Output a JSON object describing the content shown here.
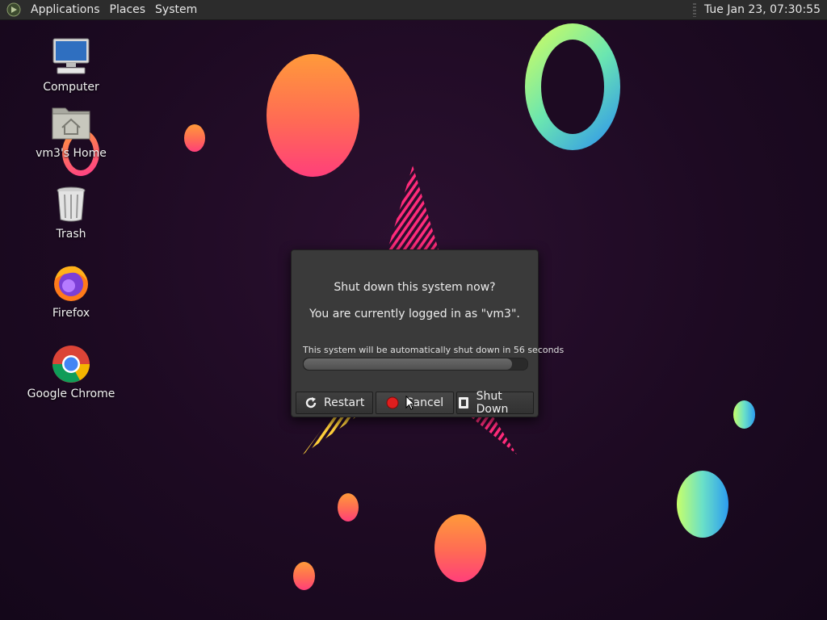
{
  "top_panel": {
    "menus": [
      "Applications",
      "Places",
      "System"
    ],
    "clock": "Tue Jan 23, 07:30:55"
  },
  "desktop": {
    "icons": [
      {
        "label": "Computer",
        "icon": "computer-icon"
      },
      {
        "label": "vm3's Home",
        "icon": "home-folder-icon"
      },
      {
        "label": "Trash",
        "icon": "trash-icon"
      },
      {
        "label": "Firefox",
        "icon": "firefox-icon"
      },
      {
        "label": "Google Chrome",
        "icon": "chrome-icon"
      }
    ]
  },
  "dialog": {
    "title": "Shut down this system now?",
    "subtitle": "You are currently logged in as \"vm3\".",
    "countdown": "This system will be automatically shut down in 56 seconds",
    "progress_fraction": 0.93,
    "buttons": {
      "restart": "Restart",
      "cancel": "Cancel",
      "shutdown": "Shut Down"
    }
  },
  "colors": {
    "panel_bg": "#2c2c2c",
    "dialog_bg": "#3a3a3a",
    "cancel_icon": "#e01e1e"
  }
}
